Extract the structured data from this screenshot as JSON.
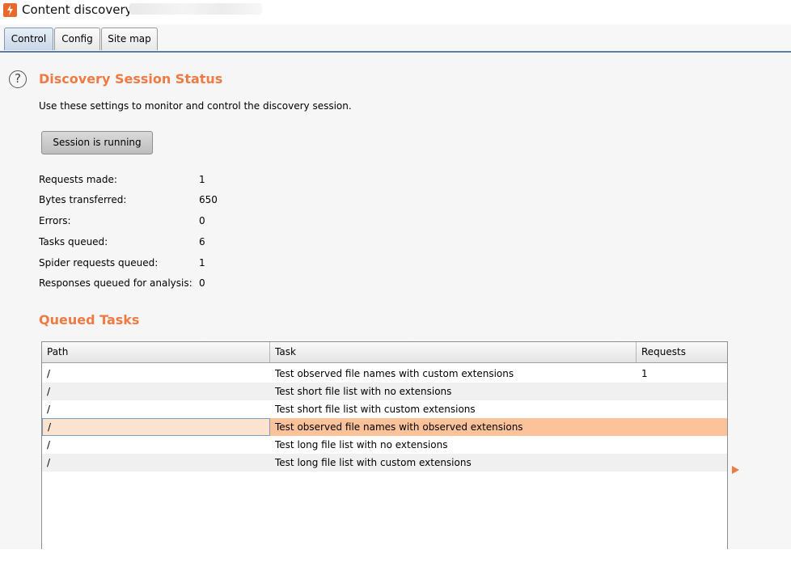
{
  "window": {
    "title": "Content discovery:"
  },
  "tabs": [
    {
      "label": "Control",
      "active": true
    },
    {
      "label": "Config",
      "active": false
    },
    {
      "label": "Site map",
      "active": false
    }
  ],
  "status_section": {
    "help_glyph": "?",
    "title": "Discovery Session Status",
    "description": "Use these settings to monitor and control the discovery session.",
    "button_label": "Session is running",
    "stats": [
      {
        "label": "Requests made:",
        "value": "1"
      },
      {
        "label": "Bytes transferred:",
        "value": "650"
      },
      {
        "label": "Errors:",
        "value": "0"
      },
      {
        "label": "Tasks queued:",
        "value": "6"
      },
      {
        "label": "Spider requests queued:",
        "value": "1"
      },
      {
        "label": "Responses queued for analysis:",
        "value": "0"
      }
    ]
  },
  "queued_tasks": {
    "title": "Queued Tasks",
    "columns": [
      "Path",
      "Task",
      "Requests"
    ],
    "rows": [
      {
        "path": "/",
        "task": "Test observed file names with custom extensions",
        "requests": "1",
        "selected": false
      },
      {
        "path": "/",
        "task": "Test short file list with no extensions",
        "requests": "",
        "selected": false
      },
      {
        "path": "/",
        "task": "Test short file list with custom extensions",
        "requests": "",
        "selected": false
      },
      {
        "path": "/",
        "task": "Test observed file names with observed extensions",
        "requests": "",
        "selected": true
      },
      {
        "path": "/",
        "task": "Test long file list with no extensions",
        "requests": "",
        "selected": false
      },
      {
        "path": "/",
        "task": "Test long file list with custom extensions",
        "requests": "",
        "selected": false
      }
    ]
  },
  "colors": {
    "accent": "#ef7a44",
    "selected_row": "#fcc39b",
    "tab_underline": "#5b7fa8"
  },
  "icons": {
    "app": "burp-logo-icon",
    "help": "help-circle-icon",
    "expand": "expand-arrow-icon"
  }
}
